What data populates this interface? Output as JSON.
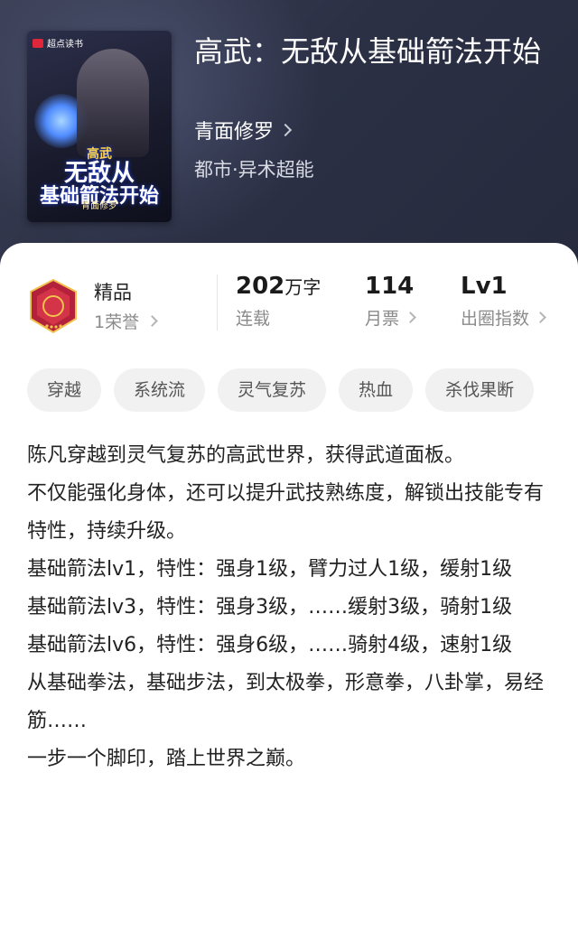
{
  "book": {
    "title": "高武：无敌从基础箭法开始",
    "author": "青面修罗",
    "category": "都市·异术超能",
    "cover": {
      "brand": "超点读书",
      "title_line1": "高武",
      "title_line2": "无敌从",
      "title_line3": "基础箭法开始",
      "author_line": "青面修罗"
    }
  },
  "honor": {
    "label": "精品",
    "count_text": "1荣誉"
  },
  "stats": {
    "word_count": {
      "value": "202",
      "unit": "万字",
      "label": "连载"
    },
    "monthly_votes": {
      "value": "114",
      "label": "月票"
    },
    "popularity": {
      "value": "Lv1",
      "label": "出圈指数"
    }
  },
  "tags": [
    "穿越",
    "系统流",
    "灵气复苏",
    "热血",
    "杀伐果断"
  ],
  "description": "陈凡穿越到灵气复苏的高武世界，获得武道面板。\n不仅能强化身体，还可以提升武技熟练度，解锁出技能专有特性，持续升级。\n基础箭法lv1，特性：强身1级，臂力过人1级，缓射1级\n基础箭法lv3，特性：强身3级，……缓射3级，骑射1级\n基础箭法lv6，特性：强身6级，……骑射4级，速射1级\n从基础拳法，基础步法，到太极拳，形意拳，八卦掌，易经筋……\n一步一个脚印，踏上世界之巅。",
  "colors": {
    "hero_bg": "#2b3045",
    "badge_red": "#b3223a",
    "badge_gold": "#f2c14e",
    "tag_bg": "#f1f1f1"
  }
}
